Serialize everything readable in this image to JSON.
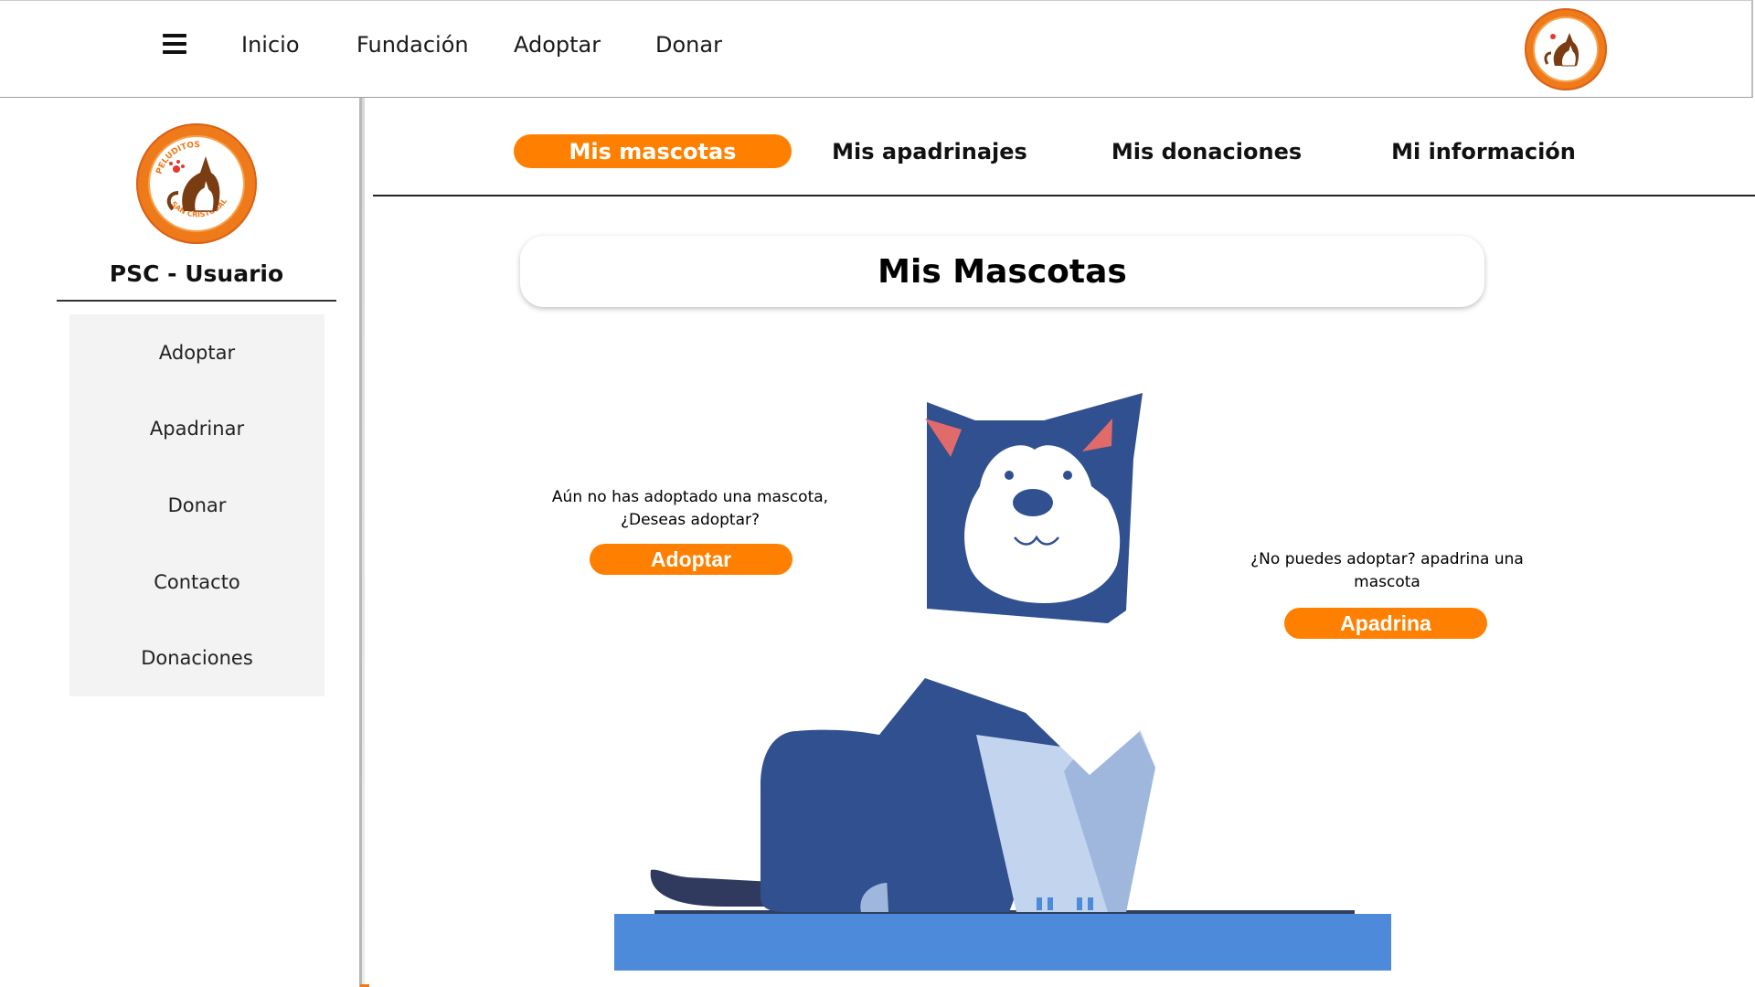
{
  "topnav": {
    "menu_icon": "hamburger-menu-icon",
    "links": [
      "Inicio",
      "Fundación",
      "Adoptar",
      "Donar"
    ],
    "logo_icon": "peluditos-san-cristobal-logo"
  },
  "sidebar": {
    "logo_text_top": "PELUDITOS",
    "logo_text_bottom": "SAN CRISTOBAL",
    "title": "PSC - Usuario",
    "items": [
      "Adoptar",
      "Apadrinar",
      "Donar",
      "Contacto",
      "Donaciones"
    ]
  },
  "tabs": [
    {
      "label": "Mis mascotas",
      "active": true
    },
    {
      "label": "Mis apadrinajes",
      "active": false
    },
    {
      "label": "Mis donaciones",
      "active": false
    },
    {
      "label": "Mi información",
      "active": false
    }
  ],
  "main": {
    "heading": "Mis Mascotas",
    "adopt_prompt_line1": "Aún no has adoptado una mascota,",
    "adopt_prompt_line2": "¿Deseas adoptar?",
    "adopt_button": "Adoptar",
    "sponsor_prompt_line1": "¿No puedes adoptar? apadrina una",
    "sponsor_prompt_line2": "mascota",
    "sponsor_button": "Apadrina",
    "illustration_icon": "cat-illustration"
  },
  "colors": {
    "accent": "#ff8000",
    "cat_dark": "#30508f",
    "cat_light": "#c3d4ef",
    "platform": "#4d8ad9"
  }
}
